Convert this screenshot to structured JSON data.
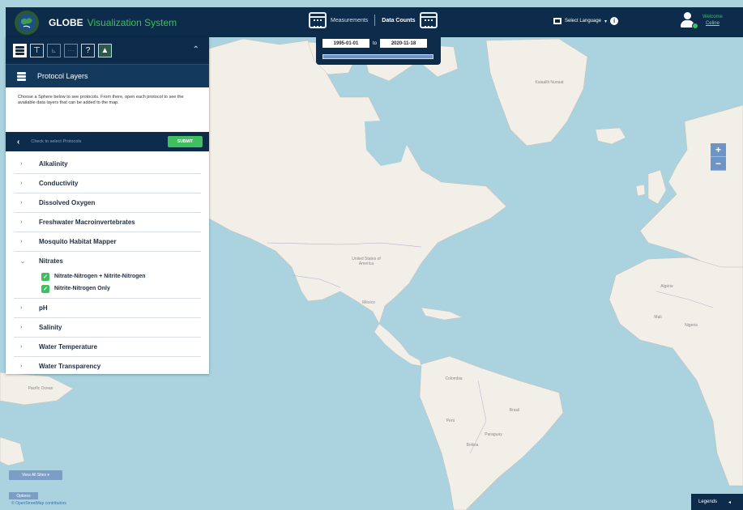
{
  "header": {
    "app_name": "GLOBE",
    "app_subtitle": "Visualization System",
    "measurements_label": "Measurements",
    "data_counts_label": "Data Counts",
    "select_language_label": "Select Language",
    "language_caret": "▾",
    "welcome_label": "Welcome",
    "welcome_sub": "Celine"
  },
  "date_range": {
    "start": "1995-01-01",
    "to_label": "to",
    "end": "2020-11-18"
  },
  "sidebar": {
    "title": "Protocol Layers",
    "description": "Choose a Sphere below to see protocols. From there, open each protocol to see the available data layers that can be added to the map.",
    "select_placeholder": "Check to select Protocols",
    "submit_label": "SUBMIT",
    "protocols": [
      {
        "label": "Alkalinity",
        "expanded": false
      },
      {
        "label": "Conductivity",
        "expanded": false
      },
      {
        "label": "Dissolved Oxygen",
        "expanded": false
      },
      {
        "label": "Freshwater Macroinvertebrates",
        "expanded": false
      },
      {
        "label": "Mosquito Habitat Mapper",
        "expanded": false
      },
      {
        "label": "Nitrates",
        "expanded": true,
        "layers": [
          {
            "label": "Nitrate-Nitrogen + Nitrite-Nitrogen",
            "checked": true
          },
          {
            "label": "Nitrite-Nitrogen Only",
            "checked": true
          }
        ]
      },
      {
        "label": "pH",
        "expanded": false
      },
      {
        "label": "Salinity",
        "expanded": false
      },
      {
        "label": "Water Temperature",
        "expanded": false
      },
      {
        "label": "Water Transparency",
        "expanded": false
      }
    ]
  },
  "map": {
    "zoom_in_label": "+",
    "zoom_out_label": "−",
    "view_button_label": "View All Sites ▾",
    "small_button_label": "Options",
    "attribution": "© OpenStreetMap contributors",
    "legends_label": "Legends",
    "legends_arrow": "◂",
    "labels": {
      "greenland": "Kalaallit Nunaat",
      "usa": "United States of America",
      "mexico": "México",
      "brasil": "Brasil",
      "colombia": "Colombia",
      "peru": "Perú",
      "bolivia": "Bolivia",
      "paraguay": "Paraguay",
      "algeria": "Algérie",
      "mali": "Mali",
      "nigeria": "Nigeria",
      "pacific": "Pacific Ocean"
    }
  },
  "colors": {
    "navy": "#0d2b4a",
    "green": "#3fbf5f",
    "water": "#aad3df",
    "land": "#f2efe9"
  }
}
